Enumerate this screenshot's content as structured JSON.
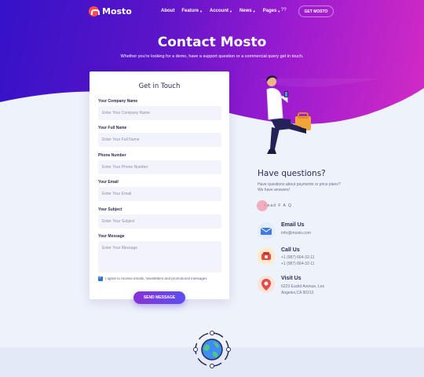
{
  "nav": {
    "logo": "Mosto",
    "menu": [
      {
        "label": "About",
        "caret": false
      },
      {
        "label": "Feature",
        "caret": true
      },
      {
        "label": "Account",
        "caret": true
      },
      {
        "label": "News",
        "caret": true
      },
      {
        "label": "Pages",
        "caret": true
      }
    ],
    "language": "??",
    "cta": "GET MOSTO"
  },
  "hero": {
    "title": "Contact Mosto",
    "subtitle": "Whether you're looking for a demo, have a support question or a commercial query get in touch."
  },
  "form": {
    "title": "Get in Touch",
    "fields": [
      {
        "label": "Your Company Name",
        "placeholder": "Enter Your Company Name"
      },
      {
        "label": "Your Full Name",
        "placeholder": "Enter Your Full Name"
      },
      {
        "label": "Phone Number",
        "placeholder": "Enter Your Phone Number"
      },
      {
        "label": "Your Email",
        "placeholder": "Enter Your Email"
      },
      {
        "label": "Your Subject",
        "placeholder": "Enter Your Subject"
      },
      {
        "label": "Your Message",
        "placeholder": "Enter Your Message"
      }
    ],
    "consent": "I agree to receive emails, newsletters and promotional messages",
    "consent_checked": true,
    "submit": "SEND MESSAGE"
  },
  "questions": {
    "title": "Have questions?",
    "text": "Have questions about payments or price plans? We have answers!",
    "faq_link": "Read F A Q"
  },
  "contacts": [
    {
      "title": "Email Us",
      "lines": [
        "Info@mosto.com"
      ],
      "icon": "envelope-icon"
    },
    {
      "title": "Call Us",
      "lines": [
        "+1 (987) 664-32-11",
        "+1 (987) 664-32-11"
      ],
      "icon": "phone-icon"
    },
    {
      "title": "Visit Us",
      "lines": [
        "6223 Euclid Avenue, Los",
        "Angeles,CA 90213"
      ],
      "icon": "map-pin-icon"
    }
  ],
  "colors": {
    "gradient_start": "#3512c8",
    "gradient_end": "#d52bc4",
    "heading": "#2c2a53",
    "button": "#5b4ff0"
  }
}
